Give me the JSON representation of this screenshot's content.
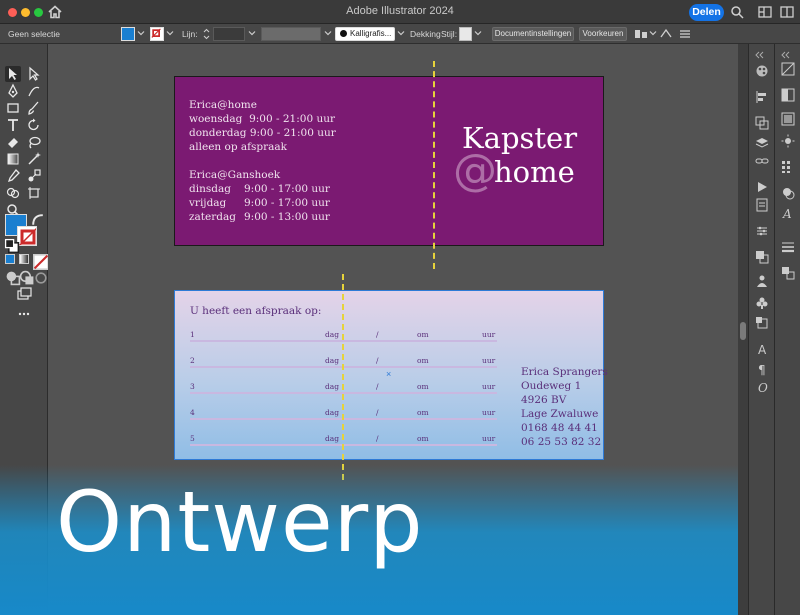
{
  "window": {
    "title": "Adobe Illustrator 2024",
    "share_label": "Delen"
  },
  "control_bar": {
    "selection": "Geen selectie",
    "stroke_label": "Lijn:",
    "brush_label": "Kalligrafis...",
    "opacity_label": "Dekking",
    "style_label": "Stijl:",
    "doc_settings_button": "Documentinstellingen",
    "preferences_button": "Voorkeuren",
    "fill_color": "#1a7fd0",
    "stroke_color": "#cc2b2b"
  },
  "artboard1": {
    "background": "#7b1a72",
    "location1": "Erica@home",
    "hours1": [
      {
        "day": "woensdag",
        "time": "9:00 - 21:00 uur"
      },
      {
        "day": "donderdag",
        "time": "9:00 - 21:00 uur"
      }
    ],
    "note": "alleen op afspraak",
    "location2": "Erica@Ganshoek",
    "hours2": [
      {
        "day": "dinsdag",
        "time": "9:00 - 17:00 uur"
      },
      {
        "day": "vrijdag",
        "time": "9:00 - 17:00 uur"
      },
      {
        "day": "zaterdag",
        "time": "9:00 - 13:00 uur"
      }
    ],
    "brand_line1": "Kapster",
    "brand_at": "@",
    "brand_line2": "home"
  },
  "artboard2": {
    "heading": "U heeft een afspraak op:",
    "rows": [
      {
        "num": "1",
        "day": "dag",
        "slash": "/",
        "at": "om",
        "unit": "uur"
      },
      {
        "num": "2",
        "day": "dag",
        "slash": "/",
        "at": "om",
        "unit": "uur"
      },
      {
        "num": "3",
        "day": "dag",
        "slash": "/",
        "at": "om",
        "unit": "uur"
      },
      {
        "num": "4",
        "day": "dag",
        "slash": "/",
        "at": "om",
        "unit": "uur"
      },
      {
        "num": "5",
        "day": "dag",
        "slash": "/",
        "at": "om",
        "unit": "uur"
      }
    ],
    "center_mark": "×",
    "address": [
      "Erica Sprangers",
      "Oudeweg 1",
      "4926 BV",
      "Lage Zwaluwe",
      "0168 48 44 41",
      "06 25 53 82 32"
    ]
  },
  "overlay_title": "Ontwerp",
  "colors": {
    "accent": "#1473e6",
    "guide": "#e6d33b",
    "overlay_gradient": "#1789c9"
  }
}
